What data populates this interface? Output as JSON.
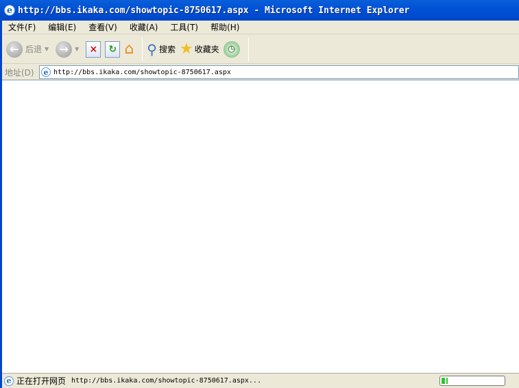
{
  "window": {
    "title": "http://bbs.ikaka.com/showtopic-8750617.aspx - Microsoft Internet Explorer"
  },
  "menu": [
    "文件(F)",
    "编辑(E)",
    "查看(V)",
    "收藏(A)",
    "工具(T)",
    "帮助(H)"
  ],
  "toolbar": {
    "back": "后退",
    "search": "搜索",
    "favorites": "收藏夹"
  },
  "address": {
    "label": "地址(D)",
    "url": "http://bbs.ikaka.com/showtopic-8750617.aspx"
  },
  "status": {
    "text": "正在打开网页",
    "url": "http://bbs.ikaka.com/showtopic-8750617.aspx...",
    "progress_percent": 10
  }
}
